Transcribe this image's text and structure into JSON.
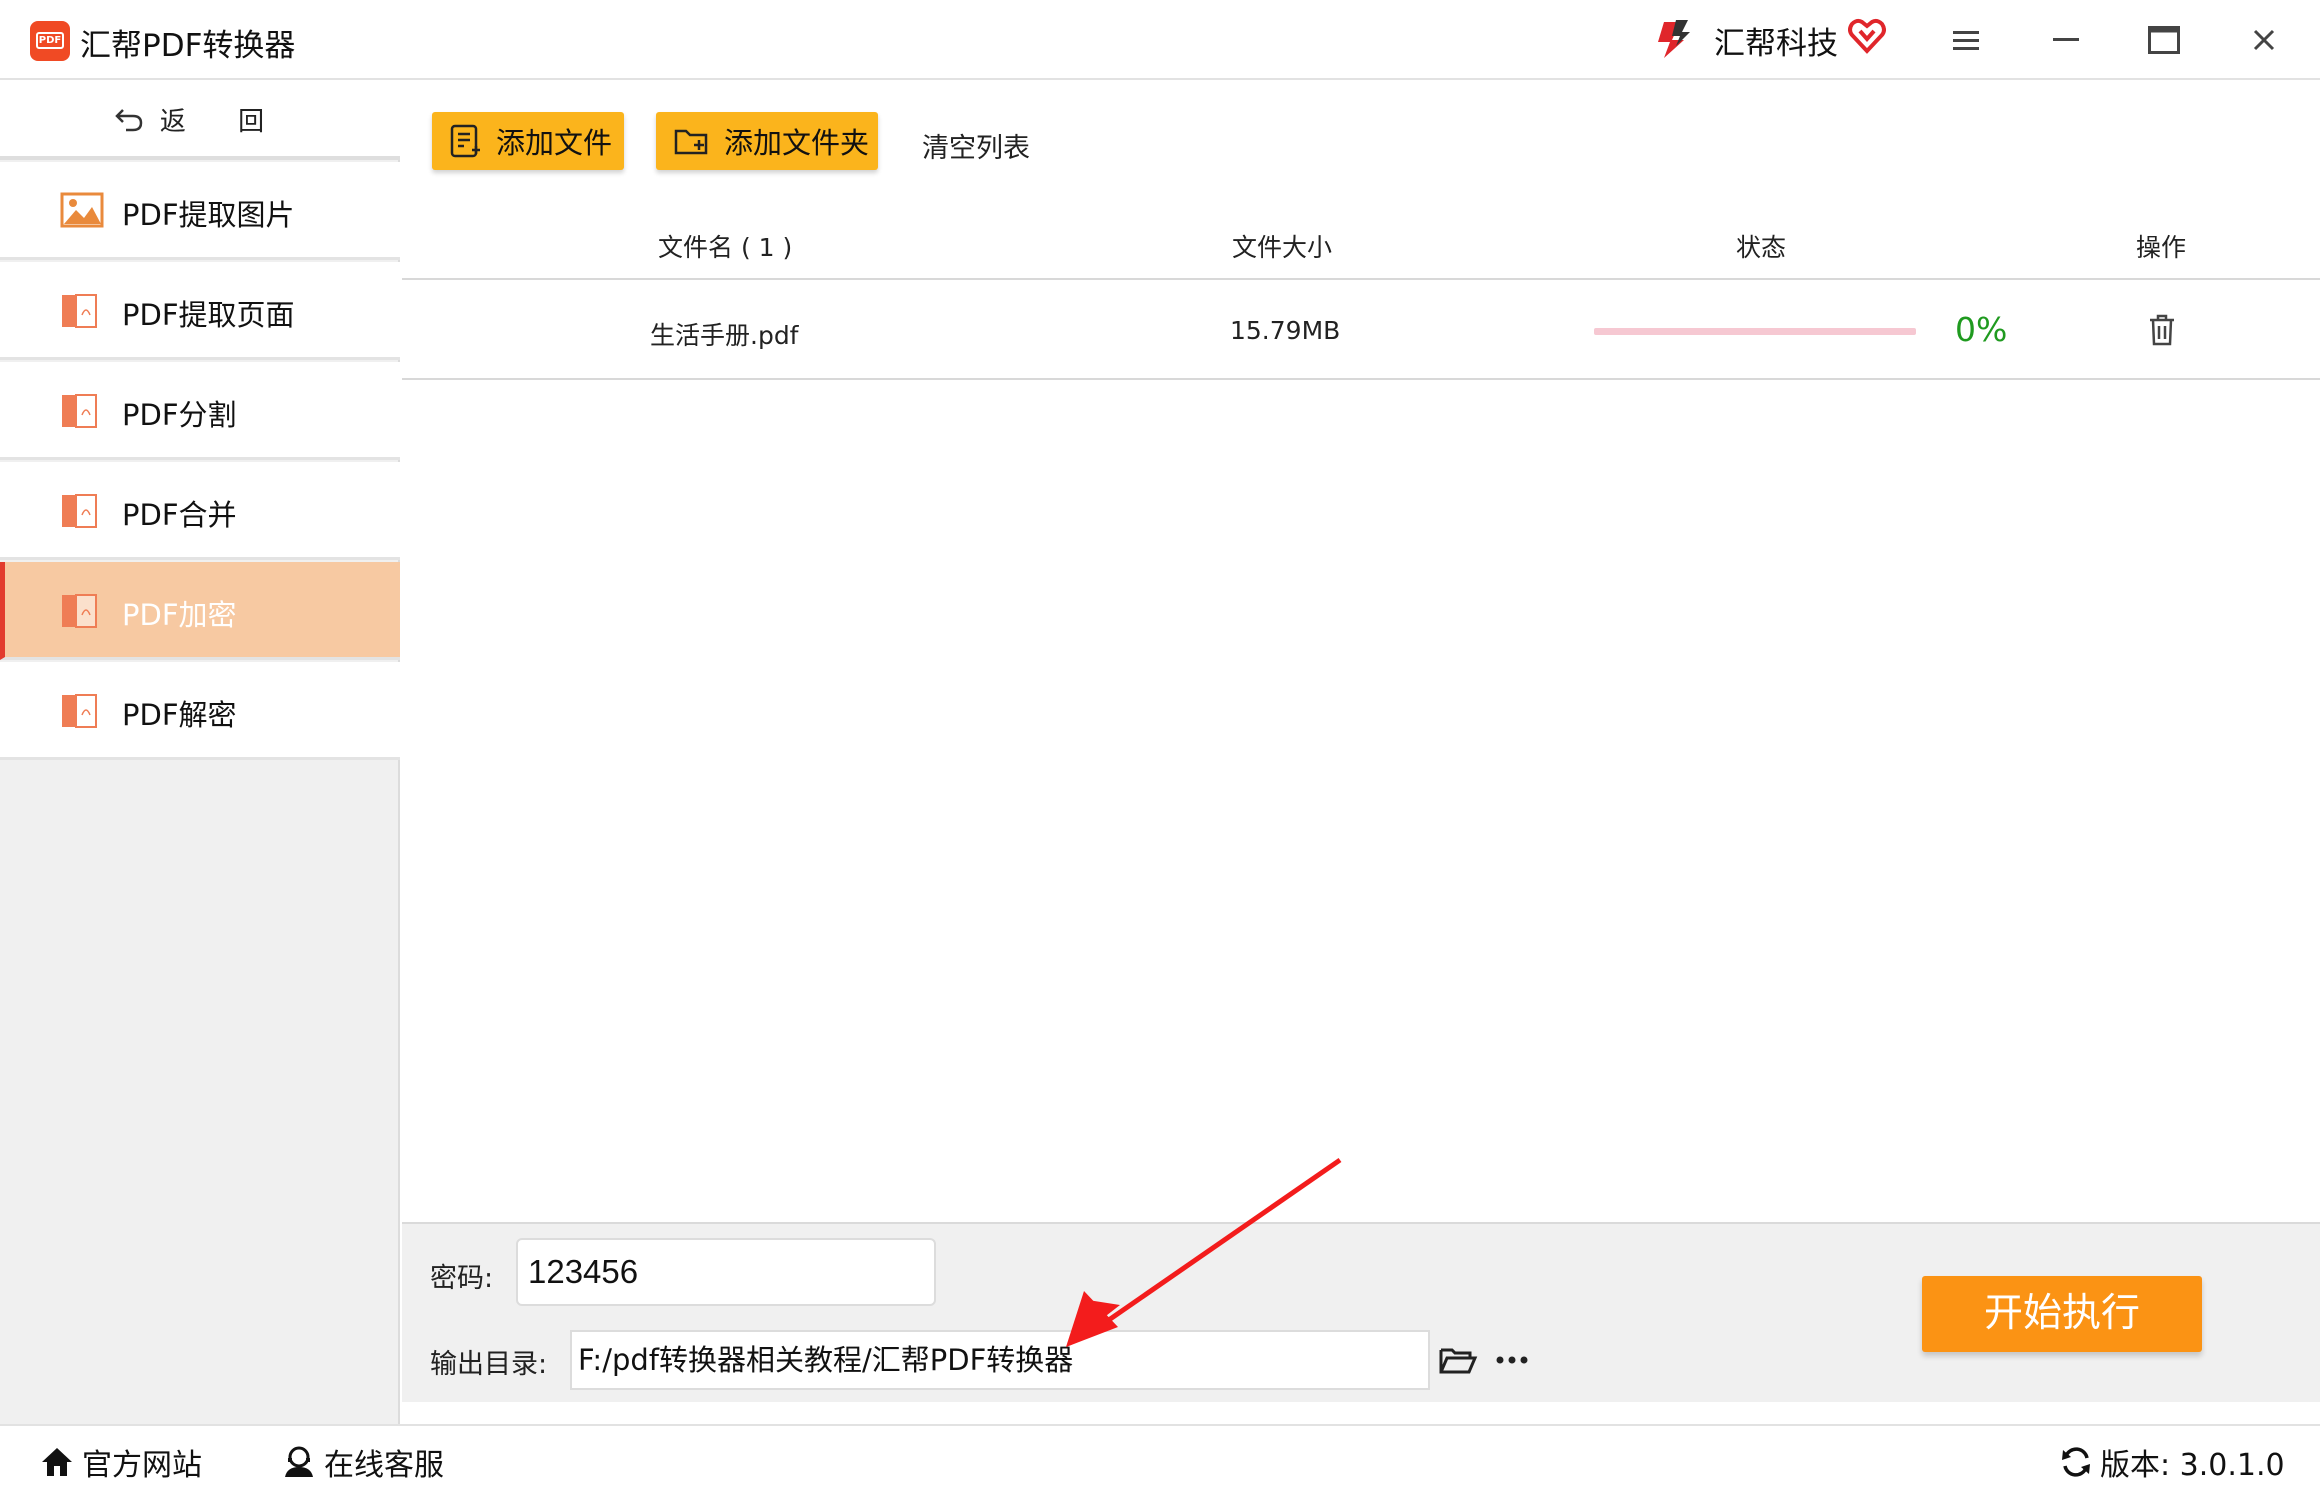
{
  "window": {
    "title": "汇帮PDF转换器",
    "logo_text": "PDF",
    "brand": "汇帮科技"
  },
  "sidebar": {
    "back_label": "返 回",
    "items": [
      {
        "label": "PDF提取图片",
        "icon": "image-icon"
      },
      {
        "label": "PDF提取页面",
        "icon": "pdf-file-icon"
      },
      {
        "label": "PDF分割",
        "icon": "pdf-file-icon"
      },
      {
        "label": "PDF合并",
        "icon": "pdf-file-icon"
      },
      {
        "label": "PDF加密",
        "icon": "pdf-file-icon",
        "active": true
      },
      {
        "label": "PDF解密",
        "icon": "pdf-file-icon"
      }
    ]
  },
  "toolbar": {
    "add_file": "添加文件",
    "add_folder": "添加文件夹",
    "clear_list": "清空列表"
  },
  "table": {
    "headers": {
      "name": "文件名 ( 1 )",
      "size": "文件大小",
      "status": "状态",
      "action": "操作"
    },
    "rows": [
      {
        "name": "生活手册.pdf",
        "size": "15.79MB",
        "progress": 0,
        "progress_text": "0%"
      }
    ]
  },
  "settings": {
    "password_label": "密码:",
    "password_value": "123456",
    "output_label": "输出目录:",
    "output_path": "F:/pdf转换器相关教程/汇帮PDF转换器",
    "start_button": "开始执行"
  },
  "footer": {
    "website": "官方网站",
    "support": "在线客服",
    "version": "版本: 3.0.1.0"
  },
  "colors": {
    "accent_yellow": "#fbb41c",
    "start_orange": "#fb9314",
    "active_nav": "#f7c9a2",
    "active_bar": "#e23b2e",
    "progress_track": "#f6c8d2",
    "progress_text": "#1f9a1f",
    "pdf_icon": "#ef7d55"
  }
}
